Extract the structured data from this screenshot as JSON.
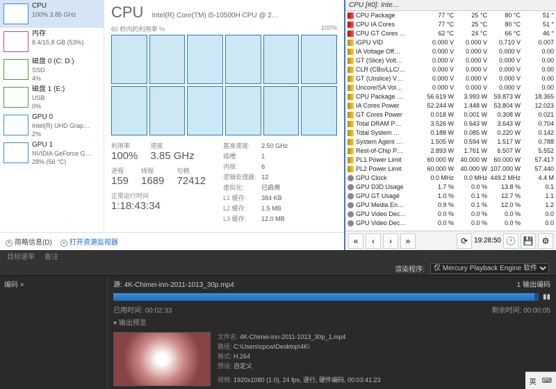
{
  "taskmgr": {
    "tiles": [
      {
        "title": "CPU",
        "sub": "100%  3.85 GHz",
        "color": "#2f8fd3",
        "sel": true
      },
      {
        "title": "内存",
        "sub": "8.4/15.8 GB (53%)",
        "color": "#c23fa0"
      },
      {
        "title": "磁盘 0 (C: D:)",
        "sub": "SSD",
        "sub2": "4%",
        "color": "#4c9a2a"
      },
      {
        "title": "磁盘 1 (E:)",
        "sub": "USB",
        "sub2": "0%",
        "color": "#4c9a2a"
      },
      {
        "title": "GPU 0",
        "sub": "Intel(R) UHD Grap…",
        "sub2": "2%",
        "color": "#2f8fd3"
      },
      {
        "title": "GPU 1",
        "sub": "NVIDIA GeForce G…",
        "sub2": "28% (56 °C)",
        "color": "#2f8fd3"
      }
    ],
    "detail": {
      "title": "CPU",
      "name": "Intel(R) Core(TM) i5-10500H CPU @ 2…",
      "graph_label": "60 秒内的利用率 %",
      "graph_right": "100%",
      "util_lbl": "利用率",
      "util": "100%",
      "speed_lbl": "速度",
      "speed": "3.85 GHz",
      "proc_lbl": "进程",
      "proc": "159",
      "thr_lbl": "线程",
      "thr": "1689",
      "hnd_lbl": "句柄",
      "hnd": "72412",
      "uptime_lbl": "正常运行时间",
      "uptime": "1:18:43:34",
      "kv": [
        {
          "k": "基准速度:",
          "v": "2.50 GHz"
        },
        {
          "k": "插槽:",
          "v": "1"
        },
        {
          "k": "内核:",
          "v": "6"
        },
        {
          "k": "逻辑处理器:",
          "v": "12"
        },
        {
          "k": "虚拟化:",
          "v": "已启用"
        },
        {
          "k": "L1 缓存:",
          "v": "384 KB"
        },
        {
          "k": "L2 缓存:",
          "v": "1.5 MB"
        },
        {
          "k": "L3 缓存:",
          "v": "12.0 MB"
        }
      ]
    },
    "footer": {
      "toggle": "简略信息(D)",
      "link": "打开资源监视器"
    }
  },
  "hwinfo": {
    "tab": "CPU [#0]: Inte…",
    "rows": [
      {
        "i": "r",
        "n": "CPU Package",
        "c": [
          "77 °C",
          "25 °C",
          "80 °C",
          "51 °"
        ]
      },
      {
        "i": "r",
        "n": "CPU IA Cores",
        "c": [
          "77 °C",
          "25 °C",
          "80 °C",
          "51 °"
        ]
      },
      {
        "i": "r",
        "n": "CPU GT Cores …",
        "c": [
          "62 °C",
          "24 °C",
          "66 °C",
          "46 °"
        ]
      },
      {
        "i": "y",
        "n": "iGPU VID",
        "c": [
          "0.000 V",
          "0.000 V",
          "0.710 V",
          "0.007"
        ]
      },
      {
        "i": "y",
        "n": "IA Voltage Off…",
        "c": [
          "0.000 V",
          "0.000 V",
          "0.000 V",
          "0.00"
        ]
      },
      {
        "i": "y",
        "n": "GT (Slice) Volt…",
        "c": [
          "0.000 V",
          "0.000 V",
          "0.000 V",
          "0.00"
        ]
      },
      {
        "i": "y",
        "n": "CLR (CBo/LLC/…",
        "c": [
          "0.000 V",
          "0.000 V",
          "0.000 V",
          "0.00"
        ]
      },
      {
        "i": "y",
        "n": "GT (Unslice) V…",
        "c": [
          "0.000 V",
          "0.000 V",
          "0.000 V",
          "0.00"
        ]
      },
      {
        "i": "y",
        "n": "Uncore/SA Vol…",
        "c": [
          "0.000 V",
          "0.000 V",
          "0.000 V",
          "0.00"
        ]
      },
      {
        "i": "y",
        "n": "CPU Package …",
        "c": [
          "56.619 W",
          "3.993 W",
          "59.873 W",
          "18.365"
        ]
      },
      {
        "i": "y",
        "n": "IA Cores Power",
        "c": [
          "52.244 W",
          "1.448 W",
          "53.804 W",
          "12.023"
        ]
      },
      {
        "i": "y",
        "n": "GT Cores Power",
        "c": [
          "0.018 W",
          "0.001 W",
          "0.308 W",
          "0.021"
        ]
      },
      {
        "i": "y",
        "n": "Total DRAM P…",
        "c": [
          "3.526 W",
          "0.643 W",
          "3.643 W",
          "0.704"
        ]
      },
      {
        "i": "y",
        "n": "Total System …",
        "c": [
          "0.188 W",
          "0.085 W",
          "0.220 W",
          "0.142"
        ]
      },
      {
        "i": "y",
        "n": "System Agent …",
        "c": [
          "1.505 W",
          "0.594 W",
          "1.517 W",
          "0.788"
        ]
      },
      {
        "i": "y",
        "n": "Rest-of-Chip P…",
        "c": [
          "2.893 W",
          "1.761 W",
          "6.507 W",
          "5.552"
        ]
      },
      {
        "i": "y",
        "n": "PL1 Power Limit",
        "c": [
          "60.000 W",
          "40.000 W",
          "60.000 W",
          "57.417"
        ]
      },
      {
        "i": "y",
        "n": "PL2 Power Limit",
        "c": [
          "60.000 W",
          "40.000 W",
          "107.000 W",
          "57.440"
        ]
      },
      {
        "i": "g",
        "n": "GPU Clock",
        "c": [
          "0.0 MHz",
          "0.0 MHz",
          "449.2 MHz",
          "4.4 M"
        ]
      },
      {
        "i": "g",
        "n": "GPU D3D Usage",
        "c": [
          "1.7 %",
          "0.0 %",
          "13.8 %",
          "0.1"
        ]
      },
      {
        "i": "g",
        "n": "GPU GT Usage",
        "c": [
          "1.0 %",
          "0.1 %",
          "12.7 %",
          "1.1"
        ]
      },
      {
        "i": "g",
        "n": "GPU Media En…",
        "c": [
          "0.9 %",
          "0.1 %",
          "12.0 %",
          "1.2"
        ]
      },
      {
        "i": "g",
        "n": "GPU Video Dec…",
        "c": [
          "0.0 %",
          "0.0 %",
          "0.0 %",
          "0.0"
        ]
      },
      {
        "i": "g",
        "n": "GPU Video Dec…",
        "c": [
          "0.0 %",
          "0.0 %",
          "0.0 %",
          "0.0"
        ]
      }
    ],
    "time": "19:28:50"
  },
  "ae": {
    "tabs": [
      "目标速率",
      "备注"
    ],
    "render_lbl": "渲染程序:",
    "render_opt": "仅 Mercury Playback Engine 软件",
    "queue_lbl": "编码 ×",
    "src_lbl": "源:",
    "src": "4K-Chimei-inn-2011-1013_30p.mp4",
    "out_count": "1 输出编码",
    "elapsed_lbl": "已用时间:",
    "elapsed": "00:02:33",
    "remain_lbl": "剩余时间:",
    "remain": "00:00:05",
    "preview_lbl": "▾ 输出预览",
    "meta": {
      "file_k": "文件名:",
      "file": "4K-Chimei-inn-2011-1013_30p_1.mp4",
      "path_k": "路径:",
      "path": "C:\\Users\\cpcw\\Desktop\\4K\\",
      "fmt_k": "格式:",
      "fmt": "H.264",
      "preset_k": "预设:",
      "preset": "自定义",
      "video_k": "视频:",
      "video": "1920x1080 (1.0), 24 fps, 逐行, 硬件编码, 00:03:41:23"
    }
  },
  "tray": {
    "ime": "英",
    "caret": "⌨"
  }
}
